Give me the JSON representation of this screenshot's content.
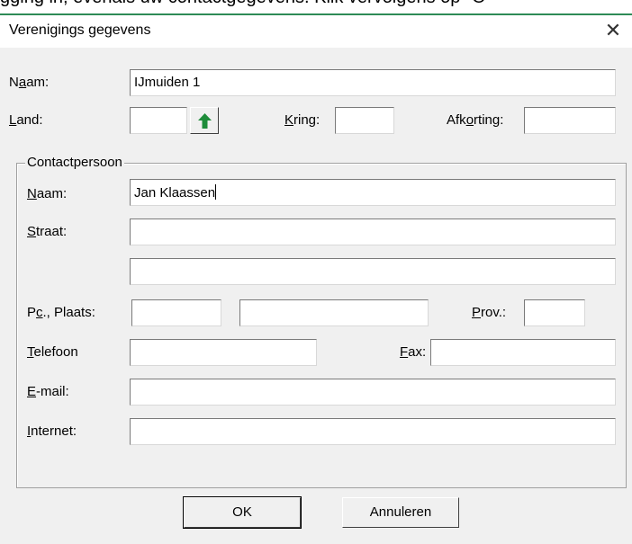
{
  "background_text": "gging in, evenals uw contactgegevens. Klik vervolgens op \"O",
  "window": {
    "title": "Verenigings gegevens",
    "close_glyph": "✕"
  },
  "vereniging": {
    "naam_label_pre": "N",
    "naam_label_u": "a",
    "naam_label_post": "am:",
    "naam_value": "IJmuiden 1",
    "land_label_pre": "",
    "land_label_u": "L",
    "land_label_post": "and:",
    "land_value": "",
    "kring_label_pre": "",
    "kring_label_u": "K",
    "kring_label_post": "ring:",
    "kring_value": "",
    "afkorting_label_pre": "Afk",
    "afkorting_label_u": "o",
    "afkorting_label_post": "rting:",
    "afkorting_value": ""
  },
  "contact": {
    "group_label": "Contactpersoon",
    "naam_label_pre": "",
    "naam_label_u": "N",
    "naam_label_post": "aam:",
    "naam_value": "Jan Klaassen",
    "straat_label_pre": "",
    "straat_label_u": "S",
    "straat_label_post": "traat:",
    "straat_value": "",
    "straat2_value": "",
    "pc_label_pre": "P",
    "pc_label_u": "c",
    "pc_label_post": "., Plaats:",
    "pc_value": "",
    "plaats_value": "",
    "prov_label_pre": "",
    "prov_label_u": "P",
    "prov_label_post": "rov.:",
    "prov_value": "",
    "telefoon_label_pre": "",
    "telefoon_label_u": "T",
    "telefoon_label_post": "elefoon",
    "telefoon_value": "",
    "fax_label_pre": "",
    "fax_label_u": "F",
    "fax_label_post": "ax:",
    "fax_value": "",
    "email_label_pre": "",
    "email_label_u": "E",
    "email_label_post": "-mail:",
    "email_value": "",
    "internet_label_pre": "",
    "internet_label_u": "I",
    "internet_label_post": "nternet:",
    "internet_value": ""
  },
  "buttons": {
    "ok": "OK",
    "cancel": "Annuleren"
  },
  "icons": {
    "land_lookup": "up-arrow-icon",
    "close": "close-icon"
  },
  "colors": {
    "arrow": "#1e8c3a",
    "dialog_bg": "#f0f0f0"
  }
}
